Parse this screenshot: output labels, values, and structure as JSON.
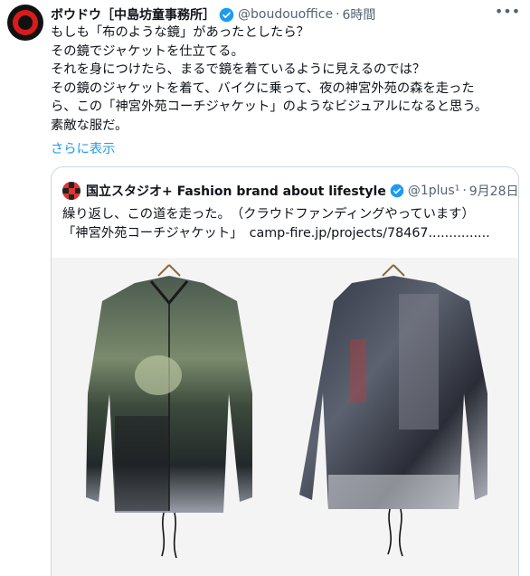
{
  "tweet": {
    "author_name": "ボウドウ［中島坊童事務所］",
    "handle": "@boudouoffice",
    "separator": "·",
    "time": "6時間",
    "more_icon": "more-dots-icon",
    "lines": [
      "もしも「布のような鏡」があったとしたら？",
      "その鏡でジャケットを仕立てる。",
      "それを身につけたら、まるで鏡を着ているように見えるのでは？",
      "その鏡のジャケットを着て、バイクに乗って、夜の神宮外苑の森を走った",
      "ら、この「神宮外苑コーチジャケット」のようなビジュアルになると思う。",
      "素敵な服だ。"
    ],
    "show_more": "さらに表示"
  },
  "quoted": {
    "author_name": "国立スタジオ+ Fashion brand about lifestyle",
    "handle": "@1plus¹",
    "separator": "·",
    "time": "9月28日",
    "lines": [
      "繰り返し、この道を走った。　（クラウドファンディングやっています）",
      "「神宮外苑コーチジャケット」　camp-fire.jp/projects/78467..............."
    ]
  },
  "colors": {
    "accent": "#1d9bf0",
    "text": "#0f1419",
    "secondary": "#536471",
    "border": "#cfd9de"
  }
}
